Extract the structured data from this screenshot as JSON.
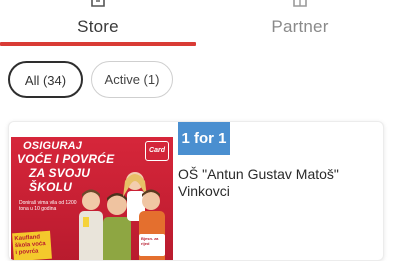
{
  "tabs": {
    "store": {
      "label": "Store",
      "icon": "store-icon",
      "selected": true
    },
    "partner": {
      "label": "Partner",
      "icon": "partner-icon",
      "selected": false
    }
  },
  "filters": {
    "all": {
      "label": "All (34)",
      "selected": true
    },
    "active": {
      "label": "Active (1)",
      "selected": false
    }
  },
  "offer_card": {
    "offer_badge": "1 for 1",
    "store_name": "OŠ \"Antun Gustav Matoš\"",
    "city": "Vinkovci",
    "promo_image": {
      "line1": "OSIGURAJ",
      "line2": "VOĆE I POVRĆE",
      "line3": "ZA SVOJU",
      "line4": "ŠKOLU",
      "subtext": "Doniraš vima vila od 1200 tona u 10 godina",
      "logo": "Card",
      "badge": "Kaufland škola voća i povrća",
      "sticker": "Bjesn. za rijed"
    }
  },
  "colors": {
    "accent": "#d93b35",
    "offer_badge": "#4a8fd0",
    "promo_background": "#c51f33"
  }
}
